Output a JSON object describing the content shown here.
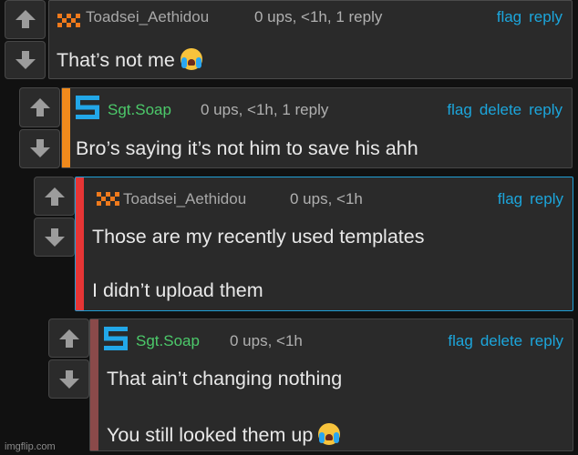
{
  "colors": {
    "background": "#111111",
    "panel": "#2a2a2a",
    "link": "#1ca6dc",
    "toadsei_username": "#a8a8a8",
    "soap_username": "#4cc96a",
    "bar_orange": "#f08a1c",
    "bar_red": "#e63535",
    "bar_brown": "#8a4a4a",
    "highlight_border": "#1f9fd6"
  },
  "comments": [
    {
      "username": "Toadsei_Aethidou",
      "meta": "0 ups, <1h, 1 reply",
      "actions": [
        "flag",
        "reply"
      ],
      "text": [
        "That’s not me"
      ],
      "emoji": "loudly-crying-face-emoji"
    },
    {
      "username": "Sgt.Soap",
      "meta": "0 ups, <1h, 1 reply",
      "actions": [
        "flag",
        "delete",
        "reply"
      ],
      "text": [
        "Bro’s saying it’s not him to save his ahh"
      ]
    },
    {
      "username": "Toadsei_Aethidou",
      "meta": "0 ups, <1h",
      "actions": [
        "flag",
        "reply"
      ],
      "text": [
        "Those are my recently used templates",
        "I didn’t upload them"
      ]
    },
    {
      "username": "Sgt.Soap",
      "meta": "0 ups, <1h",
      "actions": [
        "flag",
        "delete",
        "reply"
      ],
      "text": [
        "That ain’t changing nothing",
        "You still looked them up"
      ],
      "emoji": "loudly-crying-face-emoji"
    }
  ],
  "watermark": "imgflip.com"
}
